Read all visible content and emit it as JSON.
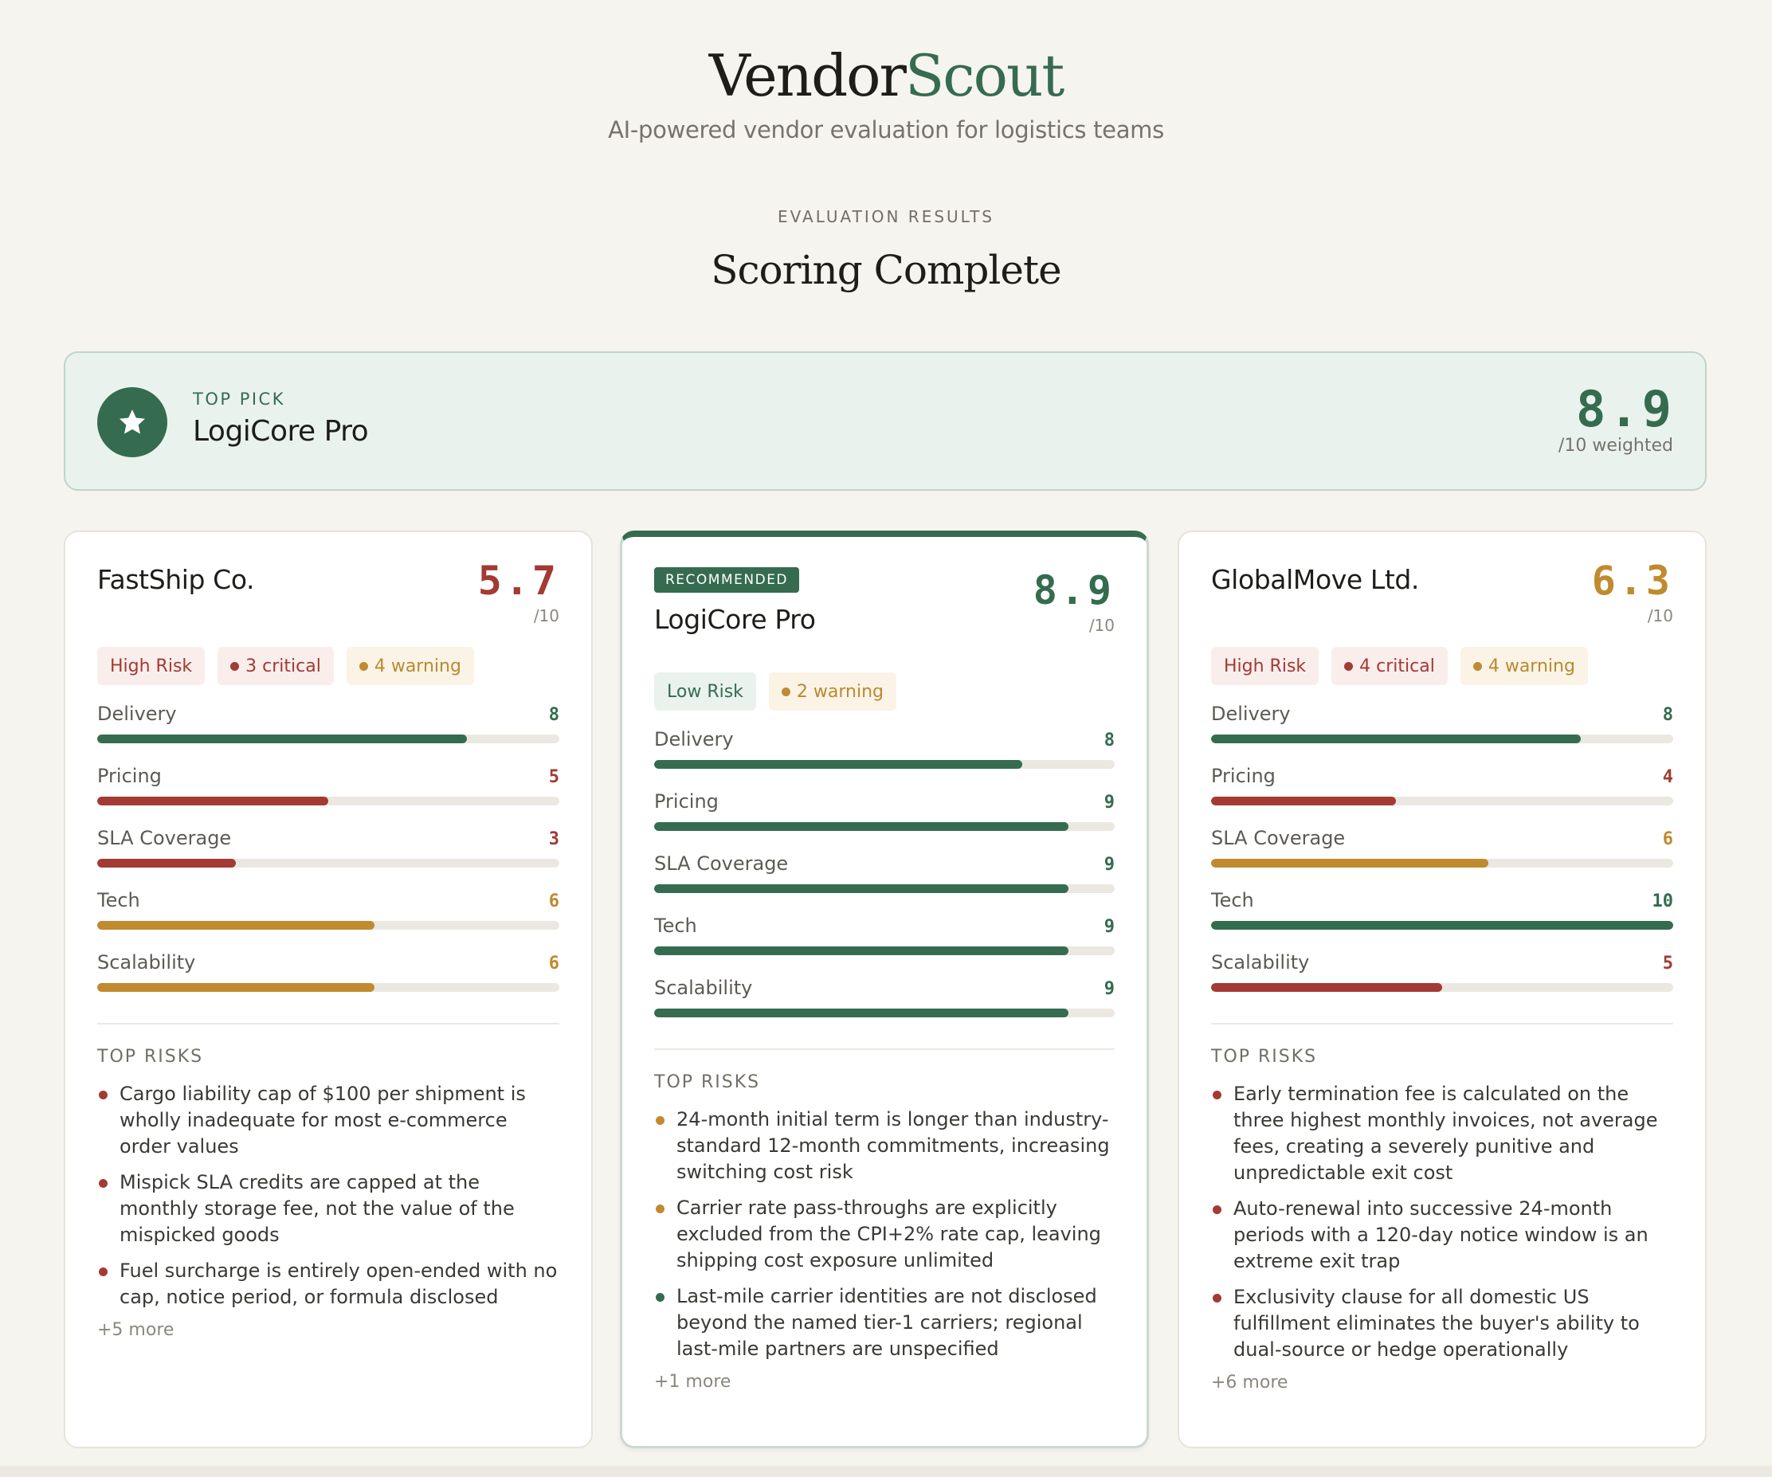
{
  "brand": {
    "name_part1": "Vendor",
    "name_part2": "Scout",
    "tagline": "AI-powered vendor evaluation for logistics teams"
  },
  "section": {
    "eyebrow": "EVALUATION RESULTS",
    "title": "Scoring Complete"
  },
  "top_pick": {
    "label": "TOP PICK",
    "name": "LogiCore Pro",
    "score": "8.9",
    "score_sub": "/10 weighted",
    "icon": "star-icon"
  },
  "colors": {
    "green": "#356c4f",
    "red": "#a33a33",
    "amber": "#c08a2e"
  },
  "cards": [
    {
      "name": "FastShip Co.",
      "score": "5.7",
      "score_sub": "/10",
      "score_color": "red",
      "risk_level": "High Risk",
      "critical": "3 critical",
      "warning": "4 warning",
      "metrics": [
        {
          "label": "Delivery",
          "value": "8",
          "level": 0.8,
          "color": "green"
        },
        {
          "label": "Pricing",
          "value": "5",
          "level": 0.5,
          "color": "red"
        },
        {
          "label": "SLA Coverage",
          "value": "3",
          "level": 0.3,
          "color": "red"
        },
        {
          "label": "Tech",
          "value": "6",
          "level": 0.6,
          "color": "amber"
        },
        {
          "label": "Scalability",
          "value": "6",
          "level": 0.6,
          "color": "amber"
        }
      ],
      "risks_title": "TOP RISKS",
      "risks": [
        {
          "text": "Cargo liability cap of $100 per shipment is wholly inadequate for most e-commerce order values",
          "severity": "red"
        },
        {
          "text": "Mispick SLA credits are capped at the monthly storage fee, not the value of the mispicked goods",
          "severity": "red"
        },
        {
          "text": "Fuel surcharge is entirely open-ended with no cap, notice period, or formula disclosed",
          "severity": "red"
        }
      ],
      "more": "+5 more"
    },
    {
      "badge": "RECOMMENDED",
      "name": "LogiCore Pro",
      "score": "8.9",
      "score_sub": "/10",
      "score_color": "green",
      "risk_level": "Low Risk",
      "warning": "2 warning",
      "metrics": [
        {
          "label": "Delivery",
          "value": "8",
          "level": 0.8,
          "color": "green"
        },
        {
          "label": "Pricing",
          "value": "9",
          "level": 0.9,
          "color": "green"
        },
        {
          "label": "SLA Coverage",
          "value": "9",
          "level": 0.9,
          "color": "green"
        },
        {
          "label": "Tech",
          "value": "9",
          "level": 0.9,
          "color": "green"
        },
        {
          "label": "Scalability",
          "value": "9",
          "level": 0.9,
          "color": "green"
        }
      ],
      "risks_title": "TOP RISKS",
      "risks": [
        {
          "text": "24-month initial term is longer than industry-standard 12-month commitments, increasing switching cost risk",
          "severity": "amber"
        },
        {
          "text": "Carrier rate pass-throughs are explicitly excluded from the CPI+2% rate cap, leaving shipping cost exposure unlimited",
          "severity": "amber"
        },
        {
          "text": "Last-mile carrier identities are not disclosed beyond the named tier-1 carriers; regional last-mile partners are unspecified",
          "severity": "green"
        }
      ],
      "more": "+1 more"
    },
    {
      "name": "GlobalMove Ltd.",
      "score": "6.3",
      "score_sub": "/10",
      "score_color": "amber",
      "risk_level": "High Risk",
      "critical": "4 critical",
      "warning": "4 warning",
      "metrics": [
        {
          "label": "Delivery",
          "value": "8",
          "level": 0.8,
          "color": "green"
        },
        {
          "label": "Pricing",
          "value": "4",
          "level": 0.4,
          "color": "red"
        },
        {
          "label": "SLA Coverage",
          "value": "6",
          "level": 0.6,
          "color": "amber"
        },
        {
          "label": "Tech",
          "value": "10",
          "level": 1.0,
          "color": "green"
        },
        {
          "label": "Scalability",
          "value": "5",
          "level": 0.5,
          "color": "red"
        }
      ],
      "risks_title": "TOP RISKS",
      "risks": [
        {
          "text": "Early termination fee is calculated on the three highest monthly invoices, not average fees, creating a severely punitive and unpredictable exit cost",
          "severity": "red"
        },
        {
          "text": "Auto-renewal into successive 24-month periods with a 120-day notice window is an extreme exit trap",
          "severity": "red"
        },
        {
          "text": "Exclusivity clause for all domestic US fulfillment eliminates the buyer's ability to dual-source or hedge operationally",
          "severity": "red"
        }
      ],
      "more": "+6 more"
    }
  ]
}
